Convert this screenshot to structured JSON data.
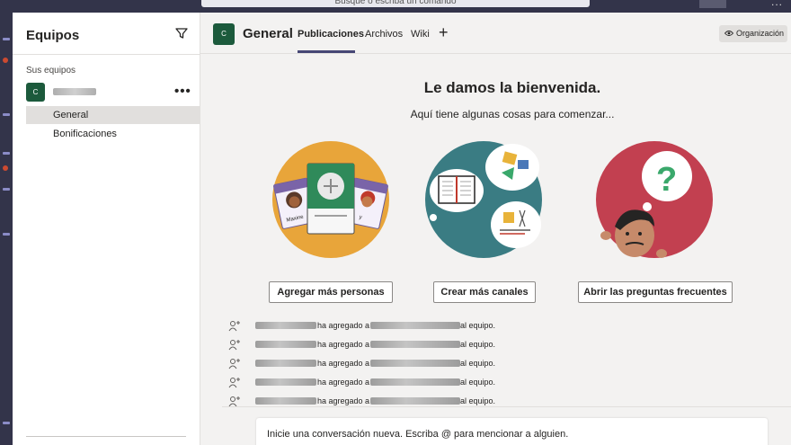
{
  "topbar": {
    "search_text": "Busque o escriba un comando",
    "more": "..."
  },
  "sidebar": {
    "title": "Equipos",
    "section_label": "Sus equipos",
    "team": {
      "avatar_letter": "C",
      "more": "•••",
      "channels": [
        {
          "label": "General",
          "active": true
        },
        {
          "label": "Bonificaciones",
          "active": false
        }
      ]
    }
  },
  "header": {
    "avatar_letter": "C",
    "title": "General",
    "tabs": [
      {
        "label": "Publicaciones",
        "active": true
      },
      {
        "label": "Archivos",
        "active": false
      },
      {
        "label": "Wiki",
        "active": false
      }
    ],
    "add_tab": "+",
    "org_label": "Organización"
  },
  "welcome": {
    "title": "Le damos la bienvenida.",
    "subtitle": "Aquí tiene algunas cosas para comenzar...",
    "actions": [
      {
        "label": "Agregar más personas",
        "icon": "people-illustration"
      },
      {
        "label": "Crear más canales",
        "icon": "channels-illustration"
      },
      {
        "label": "Abrir las preguntas frecuentes",
        "icon": "faq-illustration"
      }
    ],
    "illustration_labels": {
      "maxine": "Maxine",
      "y": "y"
    }
  },
  "activity": {
    "rows": [
      {
        "middle": "ha agregado a",
        "end": "al equipo."
      },
      {
        "middle": "ha agregado a",
        "end": "al equipo."
      },
      {
        "middle": "ha agregado a",
        "end": "al equipo."
      },
      {
        "middle": "ha agregado a",
        "end": "al equipo."
      },
      {
        "middle": "ha agregado a",
        "end": "al equipo."
      }
    ]
  },
  "compose": {
    "placeholder": "Inicie una conversación nueva. Escriba @ para mencionar a alguien."
  },
  "colors": {
    "rail": "#33344a",
    "accent": "#464775",
    "team_green": "#1c5a3c",
    "people_bg": "#e8a53a",
    "channels_bg": "#3a7c83",
    "faq_bg": "#c24050"
  }
}
